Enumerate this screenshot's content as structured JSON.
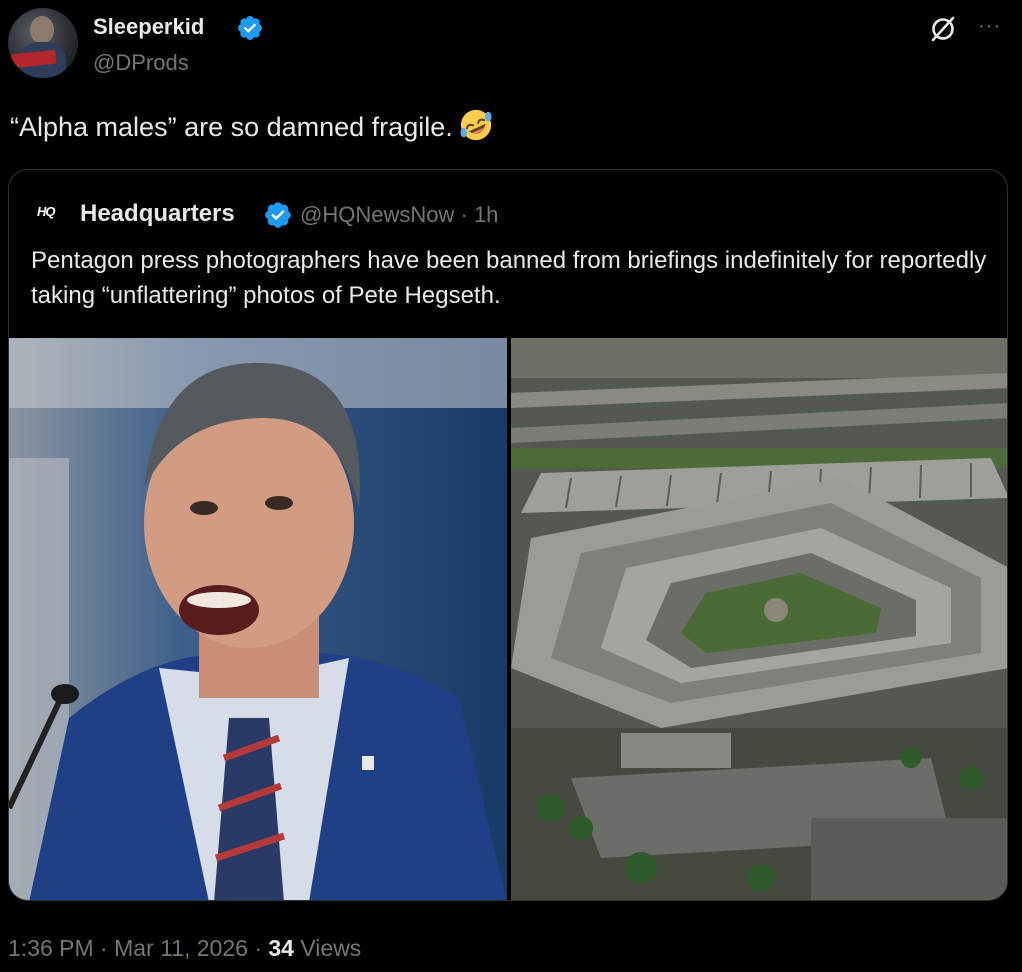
{
  "author": {
    "display_name": "Sleeperkid",
    "handle": "@DProds",
    "verified": true,
    "avatar_tag": "SLEEPERKID"
  },
  "tweet": {
    "text": "“Alpha males” are so damned fragile.",
    "emoji": "rolling-on-the-floor-laughing"
  },
  "header_actions": {
    "grok_icon": "grok-icon",
    "more_icon": "more-options-icon",
    "more_label": "···"
  },
  "quoted": {
    "logo_text": "HQ",
    "display_name": "Headquarters",
    "handle": "@HQNewsNow",
    "separator": "·",
    "time": "1h",
    "text": "Pentagon press photographers have been banned from briefings indefinitely for reportedly taking “unflattering” photos of Pete Hegseth.",
    "media": [
      {
        "name": "photo-man-shouting-at-podium"
      },
      {
        "name": "photo-pentagon-aerial"
      }
    ]
  },
  "meta": {
    "time": "1:36 PM",
    "date": "Mar 11, 2026",
    "views_count": "34",
    "views_label": "Views",
    "separator": "·"
  },
  "colors": {
    "background": "#000000",
    "text": "#e7e9ea",
    "secondary": "#71767b",
    "verified": "#1d9bf0",
    "border": "#2f3336"
  }
}
